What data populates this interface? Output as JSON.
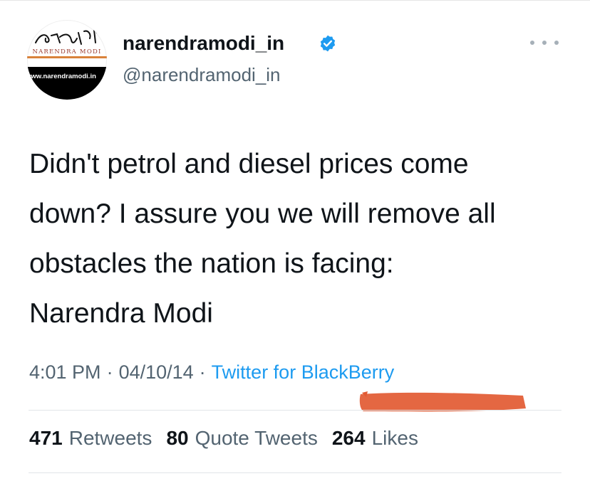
{
  "profile": {
    "avatar": {
      "logo_text": "NARENDRA MODI",
      "url_text": "www.narendramodi.in"
    },
    "display_name": "narendramodi_in",
    "handle": "@narendramodi_in",
    "verified": true,
    "more_icon": "more-horizontal-icon"
  },
  "tweet": {
    "text": "Didn't petrol and diesel prices come\ndown? I assure you we will remove all\nobstacles the nation is facing:\nNarendra Modi",
    "time": "4:01 PM",
    "date": "04/10/14",
    "separator": "·",
    "client": "Twitter for BlackBerry"
  },
  "stats": {
    "retweets": {
      "count": "471",
      "label": "Retweets"
    },
    "quotes": {
      "count": "80",
      "label": "Quote Tweets"
    },
    "likes": {
      "count": "264",
      "label": "Likes"
    }
  },
  "colors": {
    "link": "#1d9bf0",
    "secondary_text": "#536471",
    "verified": "#1d9bf0",
    "highlight": "#e25a32"
  }
}
